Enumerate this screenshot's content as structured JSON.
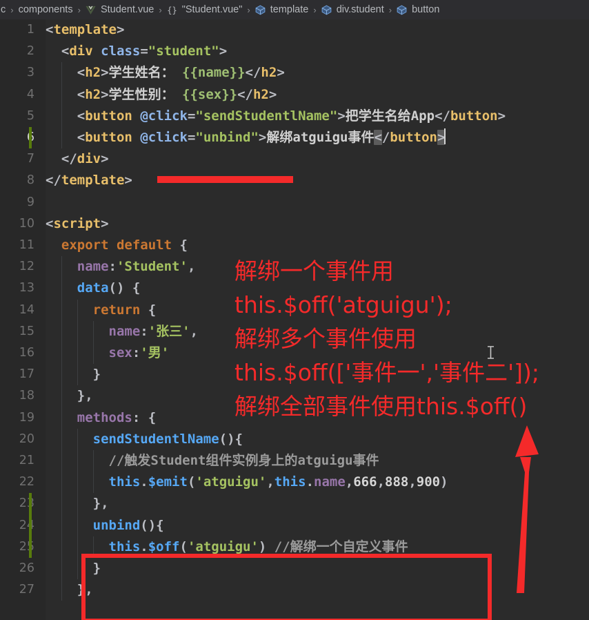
{
  "breadcrumb": {
    "items": [
      {
        "label": "c",
        "icon": "none"
      },
      {
        "label": "components",
        "icon": "none"
      },
      {
        "label": "Student.vue",
        "icon": "vue-file-icon"
      },
      {
        "label": "\"Student.vue\"",
        "icon": "braces-icon"
      },
      {
        "label": "template",
        "icon": "symbol-cube-icon"
      },
      {
        "label": "div.student",
        "icon": "symbol-cube-icon"
      },
      {
        "label": "button",
        "icon": "symbol-cube-icon"
      }
    ],
    "separator": "›"
  },
  "editor": {
    "language": "vue",
    "active_line": 6,
    "first_line": 1,
    "last_line": 27,
    "lines": [
      {
        "n": "1",
        "git": false,
        "indentGuides": [],
        "tokens": [
          {
            "t": "<",
            "c": "punct"
          },
          {
            "t": "template",
            "c": "tag"
          },
          {
            "t": ">",
            "c": "punct"
          }
        ]
      },
      {
        "n": "2",
        "git": false,
        "indentGuides": [],
        "tokens": [
          {
            "t": "  ",
            "c": "punct"
          },
          {
            "t": "<",
            "c": "punct"
          },
          {
            "t": "div",
            "c": "tag"
          },
          {
            "t": " ",
            "c": "punct"
          },
          {
            "t": "class",
            "c": "attr"
          },
          {
            "t": "=",
            "c": "punct"
          },
          {
            "t": "\"student\"",
            "c": "str"
          },
          {
            "t": ">",
            "c": "punct"
          }
        ]
      },
      {
        "n": "3",
        "git": false,
        "indentGuides": [
          1
        ],
        "tokens": [
          {
            "t": "    ",
            "c": "punct"
          },
          {
            "t": "<",
            "c": "punct"
          },
          {
            "t": "h2",
            "c": "tag"
          },
          {
            "t": ">",
            "c": "punct"
          },
          {
            "t": "学生姓名： ",
            "c": "txt"
          },
          {
            "t": "{{name}}",
            "c": "mus"
          },
          {
            "t": "</",
            "c": "punct"
          },
          {
            "t": "h2",
            "c": "tag"
          },
          {
            "t": ">",
            "c": "punct"
          }
        ]
      },
      {
        "n": "4",
        "git": false,
        "indentGuides": [
          1
        ],
        "tokens": [
          {
            "t": "    ",
            "c": "punct"
          },
          {
            "t": "<",
            "c": "punct"
          },
          {
            "t": "h2",
            "c": "tag"
          },
          {
            "t": ">",
            "c": "punct"
          },
          {
            "t": "学生性别： ",
            "c": "txt"
          },
          {
            "t": "{{sex}}",
            "c": "mus"
          },
          {
            "t": "</",
            "c": "punct"
          },
          {
            "t": "h2",
            "c": "tag"
          },
          {
            "t": ">",
            "c": "punct"
          }
        ]
      },
      {
        "n": "5",
        "git": false,
        "indentGuides": [
          1
        ],
        "tokens": [
          {
            "t": "    ",
            "c": "punct"
          },
          {
            "t": "<",
            "c": "punct"
          },
          {
            "t": "button",
            "c": "tag"
          },
          {
            "t": " ",
            "c": "punct"
          },
          {
            "t": "@click",
            "c": "attr"
          },
          {
            "t": "=",
            "c": "punct"
          },
          {
            "t": "\"sendStudentlName\"",
            "c": "str"
          },
          {
            "t": ">",
            "c": "punct"
          },
          {
            "t": "把学生名给App",
            "c": "txt"
          },
          {
            "t": "</",
            "c": "punct"
          },
          {
            "t": "button",
            "c": "tag"
          },
          {
            "t": ">",
            "c": "punct"
          }
        ]
      },
      {
        "n": "6",
        "git": true,
        "active": true,
        "indentGuides": [
          1
        ],
        "tokens": [
          {
            "t": "    ",
            "c": "punct"
          },
          {
            "t": "<",
            "c": "punct"
          },
          {
            "t": "button",
            "c": "tag"
          },
          {
            "t": " ",
            "c": "punct"
          },
          {
            "t": "@click",
            "c": "attr"
          },
          {
            "t": "=",
            "c": "punct"
          },
          {
            "t": "\"unbind\"",
            "c": "str"
          },
          {
            "t": ">",
            "c": "punct"
          },
          {
            "t": "解绑atguigu事件",
            "c": "txt"
          },
          {
            "t": "<",
            "c": "punct bracket-hl"
          },
          {
            "t": "/",
            "c": "punct"
          },
          {
            "t": "button",
            "c": "tag"
          },
          {
            "t": ">",
            "c": "punct bracket-hl"
          },
          {
            "t": "",
            "c": "caret"
          }
        ]
      },
      {
        "n": "7",
        "git": false,
        "indentGuides": [],
        "tokens": [
          {
            "t": "  ",
            "c": "punct"
          },
          {
            "t": "</",
            "c": "punct"
          },
          {
            "t": "div",
            "c": "tag"
          },
          {
            "t": ">",
            "c": "punct"
          }
        ]
      },
      {
        "n": "8",
        "git": false,
        "indentGuides": [],
        "tokens": [
          {
            "t": "</",
            "c": "punct"
          },
          {
            "t": "template",
            "c": "tag"
          },
          {
            "t": ">",
            "c": "punct"
          }
        ]
      },
      {
        "n": "9",
        "git": false,
        "indentGuides": [],
        "tokens": []
      },
      {
        "n": "10",
        "git": false,
        "indentGuides": [],
        "tokens": [
          {
            "t": "<",
            "c": "punct"
          },
          {
            "t": "script",
            "c": "tag"
          },
          {
            "t": ">",
            "c": "punct"
          }
        ]
      },
      {
        "n": "11",
        "git": false,
        "indentGuides": [],
        "tokens": [
          {
            "t": "  ",
            "c": "punct"
          },
          {
            "t": "export",
            "c": "kw"
          },
          {
            "t": " ",
            "c": "punct"
          },
          {
            "t": "default",
            "c": "kw"
          },
          {
            "t": " ",
            "c": "punct"
          },
          {
            "t": "{",
            "c": "punct"
          }
        ]
      },
      {
        "n": "12",
        "git": false,
        "indentGuides": [
          1
        ],
        "tokens": [
          {
            "t": "    ",
            "c": "punct"
          },
          {
            "t": "name",
            "c": "prop"
          },
          {
            "t": ":",
            "c": "punct"
          },
          {
            "t": "'Student'",
            "c": "str"
          },
          {
            "t": ",",
            "c": "punct"
          }
        ]
      },
      {
        "n": "13",
        "git": false,
        "indentGuides": [
          1
        ],
        "tokens": [
          {
            "t": "    ",
            "c": "punct"
          },
          {
            "t": "data",
            "c": "fn"
          },
          {
            "t": "() ",
            "c": "punct"
          },
          {
            "t": "{",
            "c": "punct"
          }
        ]
      },
      {
        "n": "14",
        "git": false,
        "indentGuides": [
          1,
          2
        ],
        "tokens": [
          {
            "t": "      ",
            "c": "punct"
          },
          {
            "t": "return",
            "c": "kw"
          },
          {
            "t": " ",
            "c": "punct"
          },
          {
            "t": "{",
            "c": "punct"
          }
        ]
      },
      {
        "n": "15",
        "git": false,
        "indentGuides": [
          1,
          2,
          3
        ],
        "tokens": [
          {
            "t": "        ",
            "c": "punct"
          },
          {
            "t": "name",
            "c": "prop"
          },
          {
            "t": ":",
            "c": "punct"
          },
          {
            "t": "'张三'",
            "c": "str"
          },
          {
            "t": ",",
            "c": "punct"
          }
        ]
      },
      {
        "n": "16",
        "git": false,
        "indentGuides": [
          1,
          2,
          3
        ],
        "tokens": [
          {
            "t": "        ",
            "c": "punct"
          },
          {
            "t": "sex",
            "c": "prop"
          },
          {
            "t": ":",
            "c": "punct"
          },
          {
            "t": "'男'",
            "c": "str"
          }
        ]
      },
      {
        "n": "17",
        "git": false,
        "indentGuides": [
          1,
          2
        ],
        "tokens": [
          {
            "t": "      ",
            "c": "punct"
          },
          {
            "t": "}",
            "c": "punct"
          }
        ]
      },
      {
        "n": "18",
        "git": false,
        "indentGuides": [
          1
        ],
        "tokens": [
          {
            "t": "    ",
            "c": "punct"
          },
          {
            "t": "}",
            "c": "punct"
          },
          {
            "t": ",",
            "c": "punct"
          }
        ]
      },
      {
        "n": "19",
        "git": false,
        "indentGuides": [
          1
        ],
        "tokens": [
          {
            "t": "    ",
            "c": "punct"
          },
          {
            "t": "methods",
            "c": "prop"
          },
          {
            "t": ": ",
            "c": "punct"
          },
          {
            "t": "{",
            "c": "punct"
          }
        ]
      },
      {
        "n": "20",
        "git": false,
        "indentGuides": [
          1,
          2
        ],
        "tokens": [
          {
            "t": "      ",
            "c": "punct"
          },
          {
            "t": "sendStudentlName",
            "c": "fn"
          },
          {
            "t": "(){",
            "c": "punct"
          }
        ]
      },
      {
        "n": "21",
        "git": false,
        "indentGuides": [
          1,
          2,
          3
        ],
        "tokens": [
          {
            "t": "        ",
            "c": "punct"
          },
          {
            "t": "//触发Student组件实例身上的atguigu事件",
            "c": "cmt"
          }
        ]
      },
      {
        "n": "22",
        "git": false,
        "indentGuides": [
          1,
          2,
          3
        ],
        "tokens": [
          {
            "t": "        ",
            "c": "punct"
          },
          {
            "t": "this",
            "c": "ths"
          },
          {
            "t": ".",
            "c": "punct"
          },
          {
            "t": "$emit",
            "c": "fn"
          },
          {
            "t": "(",
            "c": "punct"
          },
          {
            "t": "'atguigu'",
            "c": "str"
          },
          {
            "t": ",",
            "c": "punct"
          },
          {
            "t": "this",
            "c": "ths"
          },
          {
            "t": ".",
            "c": "punct"
          },
          {
            "t": "name",
            "c": "prop"
          },
          {
            "t": ",",
            "c": "punct"
          },
          {
            "t": "666",
            "c": "num"
          },
          {
            "t": ",",
            "c": "punct"
          },
          {
            "t": "888",
            "c": "num"
          },
          {
            "t": ",",
            "c": "punct"
          },
          {
            "t": "900",
            "c": "num"
          },
          {
            "t": ")",
            "c": "punct"
          }
        ]
      },
      {
        "n": "23",
        "git": true,
        "indentGuides": [
          1,
          2
        ],
        "tokens": [
          {
            "t": "      ",
            "c": "punct"
          },
          {
            "t": "}",
            "c": "punct"
          },
          {
            "t": ",",
            "c": "punct"
          }
        ]
      },
      {
        "n": "24",
        "git": true,
        "indentGuides": [
          1,
          2
        ],
        "tokens": [
          {
            "t": "      ",
            "c": "punct"
          },
          {
            "t": "unbind",
            "c": "fn"
          },
          {
            "t": "(){",
            "c": "punct"
          }
        ]
      },
      {
        "n": "25",
        "git": true,
        "indentGuides": [
          1,
          2,
          3
        ],
        "tokens": [
          {
            "t": "        ",
            "c": "punct"
          },
          {
            "t": "this",
            "c": "ths"
          },
          {
            "t": ".",
            "c": "punct"
          },
          {
            "t": "$off",
            "c": "fn"
          },
          {
            "t": "(",
            "c": "punct"
          },
          {
            "t": "'atguigu'",
            "c": "str"
          },
          {
            "t": ") ",
            "c": "punct"
          },
          {
            "t": "//解绑一个自定义事件",
            "c": "cmt"
          }
        ]
      },
      {
        "n": "26",
        "git": false,
        "indentGuides": [
          1,
          2
        ],
        "tokens": [
          {
            "t": "      ",
            "c": "punct"
          },
          {
            "t": "}",
            "c": "punct"
          }
        ]
      },
      {
        "n": "27",
        "git": false,
        "indentGuides": [
          1
        ],
        "tokens": [
          {
            "t": "    ",
            "c": "punct"
          },
          {
            "t": "}",
            "c": "punct"
          },
          {
            "t": ",",
            "c": "punct"
          }
        ]
      }
    ]
  },
  "annotations": {
    "color": "#f42a2a",
    "note_lines": [
      "解绑一个事件用",
      "this.$off('atguigu');",
      "解绑多个事件使用",
      "this.$off(['事件一','事件二']);",
      "解绑全部事件使用this.$off()"
    ],
    "underline": {
      "name": "red-underline-line6"
    },
    "box": {
      "name": "red-highlight-box-unbind-method"
    },
    "arrow": {
      "name": "red-arrow-pointing-up"
    }
  },
  "colors": {
    "editor_background": "#2b2b2b",
    "gutter_background": "#282828",
    "breadcrumb_background": "#2d2d30",
    "annotation_red": "#f42a2a",
    "git_modified_green": "#587c0c",
    "tag": "#e8bf6a",
    "string": "#a5c261",
    "keyword": "#cc7832",
    "function": "#56a8f5",
    "comment": "#9b9b9b"
  }
}
